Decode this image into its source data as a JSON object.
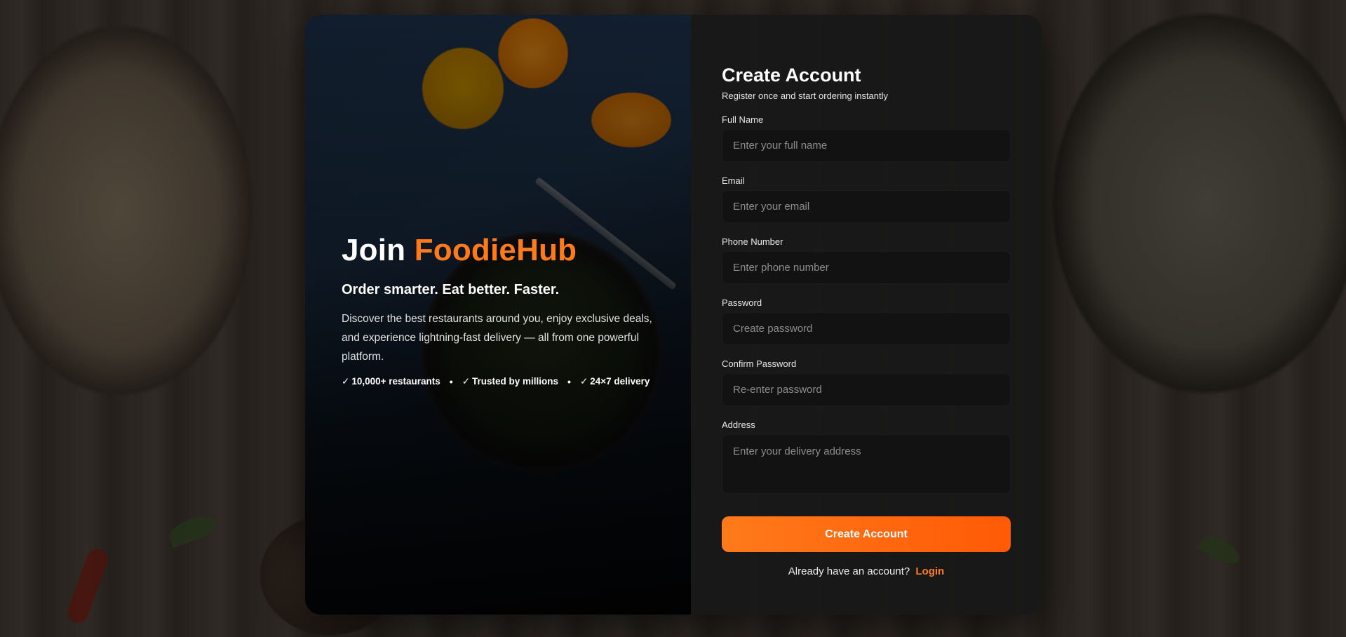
{
  "promo": {
    "title_prefix": "Join",
    "brand": "FoodieHub",
    "subtitle": "Order smarter. Eat better. Faster.",
    "description": "Discover the best restaurants around you, enjoy exclusive deals, and experience lightning-fast delivery — all from one powerful platform.",
    "features": [
      {
        "icon": "✓",
        "label": "10,000+ restaurants"
      },
      {
        "icon": "✓",
        "label": "Trusted by millions"
      },
      {
        "icon": "✓",
        "label": "24×7 delivery"
      }
    ],
    "separator": "•"
  },
  "form": {
    "title": "Create Account",
    "subtitle": "Register once and start ordering instantly",
    "fields": {
      "full_name": {
        "label": "Full Name",
        "placeholder": "Enter your full name",
        "value": ""
      },
      "email": {
        "label": "Email",
        "placeholder": "Enter your email",
        "value": ""
      },
      "phone": {
        "label": "Phone Number",
        "placeholder": "Enter phone number",
        "value": ""
      },
      "password": {
        "label": "Password",
        "placeholder": "Create password",
        "value": ""
      },
      "confirm_password": {
        "label": "Confirm Password",
        "placeholder": "Re-enter password",
        "value": ""
      },
      "address": {
        "label": "Address",
        "placeholder": "Enter your delivery address",
        "value": ""
      }
    },
    "submit_label": "Create Account",
    "login_prompt": "Already have an account?",
    "login_link": "Login"
  },
  "colors": {
    "accent": "#ff7a1a",
    "accent_dark": "#ff5a06",
    "panel": "#181818",
    "input_bg": "#121212"
  }
}
